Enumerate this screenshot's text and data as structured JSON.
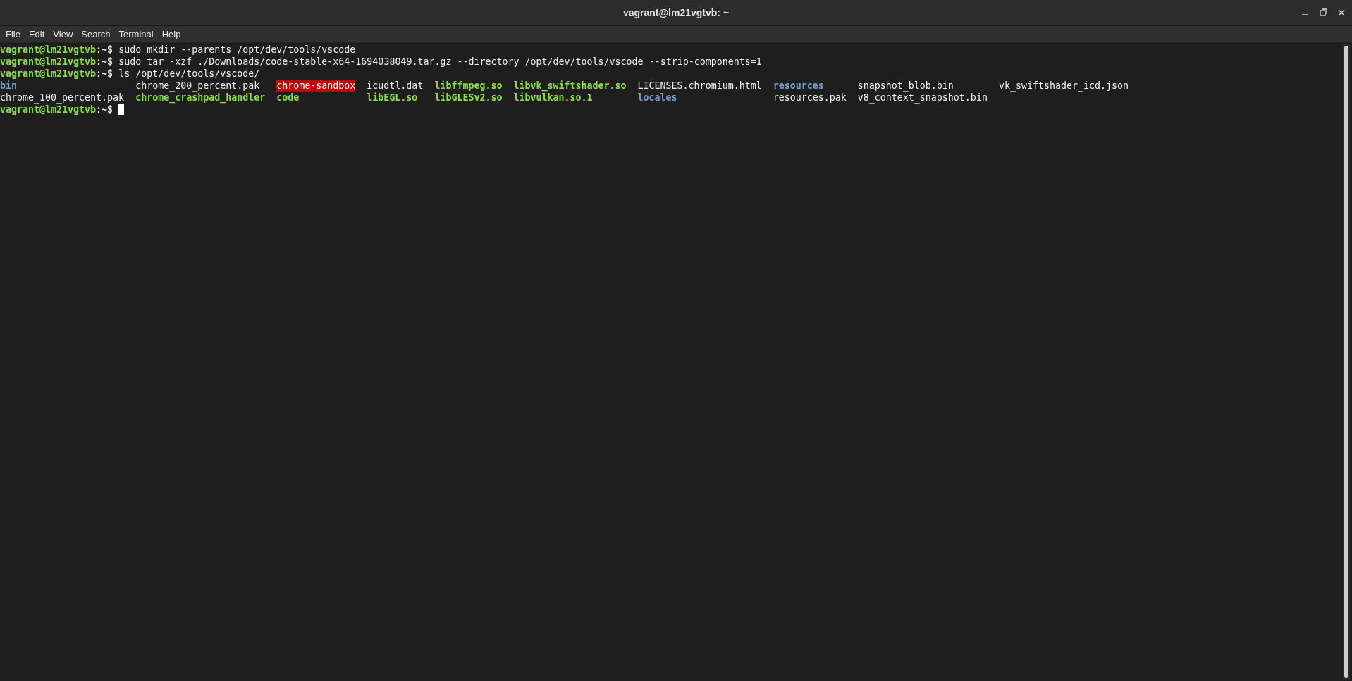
{
  "window": {
    "title": "vagrant@lm21vgtvb: ~"
  },
  "menu": [
    "File",
    "Edit",
    "View",
    "Search",
    "Terminal",
    "Help"
  ],
  "lines": [
    {
      "prompt": "vagrant@lm21vgtvb",
      "suffix": ":~$",
      "command": "sudo mkdir --parents /opt/dev/tools/vscode"
    },
    {
      "prompt": "vagrant@lm21vgtvb",
      "suffix": ":~$",
      "command": "sudo tar -xzf ./Downloads/code-stable-x64-1694038049.tar.gz --directory /opt/dev/tools/vscode --strip-components=1"
    },
    {
      "prompt": "vagrant@lm21vgtvb",
      "suffix": ":~$",
      "command": "ls /opt/dev/tools/vscode/"
    }
  ],
  "listing": [
    [
      {
        "name": "bin",
        "kind": "dir"
      },
      {
        "name": "chrome_100_percent.pak",
        "kind": "file"
      }
    ],
    [
      {
        "name": "chrome_200_percent.pak",
        "kind": "file"
      },
      {
        "name": "chrome_crashpad_handler",
        "kind": "exec"
      }
    ],
    [
      {
        "name": "chrome-sandbox",
        "kind": "setuid"
      },
      {
        "name": "code",
        "kind": "exec"
      }
    ],
    [
      {
        "name": "icudtl.dat",
        "kind": "file"
      },
      {
        "name": "libEGL.so",
        "kind": "exec"
      }
    ],
    [
      {
        "name": "libffmpeg.so",
        "kind": "exec"
      },
      {
        "name": "libGLESv2.so",
        "kind": "exec"
      }
    ],
    [
      {
        "name": "libvk_swiftshader.so",
        "kind": "exec"
      },
      {
        "name": "libvulkan.so.1",
        "kind": "exec"
      }
    ],
    [
      {
        "name": "LICENSES.chromium.html",
        "kind": "file"
      },
      {
        "name": "locales",
        "kind": "dir"
      }
    ],
    [
      {
        "name": "resources",
        "kind": "dir"
      },
      {
        "name": "resources.pak",
        "kind": "file"
      }
    ],
    [
      {
        "name": "snapshot_blob.bin",
        "kind": "file"
      },
      {
        "name": "v8_context_snapshot.bin",
        "kind": "file"
      }
    ],
    [
      {
        "name": "vk_swiftshader_icd.json",
        "kind": "file"
      }
    ]
  ],
  "current_prompt": {
    "prompt": "vagrant@lm21vgtvb",
    "suffix": ":~$"
  }
}
